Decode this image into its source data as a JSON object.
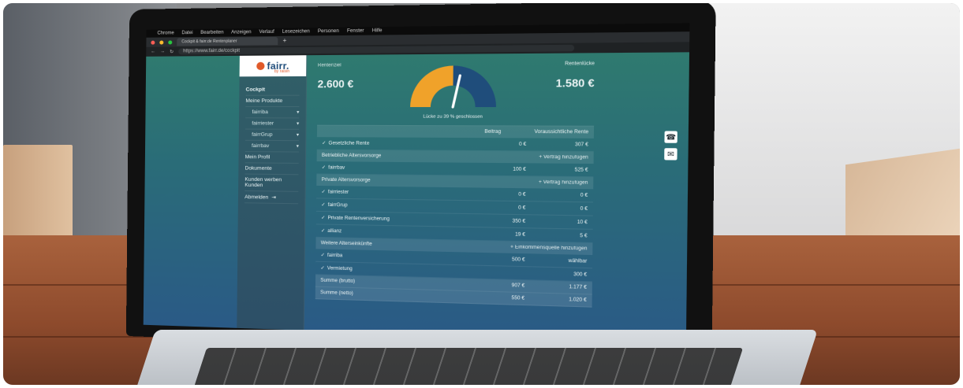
{
  "colors": {
    "brand_orange": "#e05a2a",
    "brand_blue": "#1f4d7b",
    "gauge_blue": "#1f4d7b",
    "gauge_orange": "#f0a22a",
    "app_gradient_top": "#2f7a6f",
    "app_gradient_bottom": "#2a5a86"
  },
  "browser": {
    "menubar": [
      "Chrome",
      "Datei",
      "Bearbeiten",
      "Anzeigen",
      "Verlauf",
      "Lesezeichen",
      "Personen",
      "Fenster",
      "Hilfe"
    ],
    "tab_title": "Cockpit & fairr.de Rentenplaner",
    "url": "https://www.fairr.de/cockpit"
  },
  "app": {
    "logo_text": "fairr.",
    "logo_sub": "by raisin",
    "sidebar": {
      "items": [
        {
          "label": "Cockpit",
          "active": true
        },
        {
          "label": "Meine Produkte",
          "active": false
        }
      ],
      "subitems": [
        {
          "label": "fairriba"
        },
        {
          "label": "fairriester"
        },
        {
          "label": "fairrGrup"
        },
        {
          "label": "fairrbav"
        }
      ],
      "after": [
        {
          "label": "Mein Profil"
        },
        {
          "label": "Dokumente"
        },
        {
          "label": "Kunden werben Kunden"
        }
      ],
      "logout_label": "Abmelden"
    },
    "kpis": {
      "left_label": "Rentenziel",
      "left_value": "2.600 €",
      "right_label": "Rentenlücke",
      "right_value": "1.580 €",
      "gauge_caption": "Lücke zu 39 % geschlossen"
    },
    "table": {
      "headers": [
        "Beitrag",
        "Voraussichtliche Rente"
      ],
      "rows_main": [
        {
          "type": "row",
          "name": "Gesetzliche Rente",
          "beitrag": "0 €",
          "rente": "307 €"
        },
        {
          "type": "section",
          "title": "Betriebliche Altersvorsorge",
          "action": "+ Vertrag hinzufügen"
        },
        {
          "type": "row",
          "name": "fairrbav",
          "beitrag": "100 €",
          "rente": "525 €"
        },
        {
          "type": "section",
          "title": "Private Altersvorsorge",
          "action": "+ Vertrag hinzufügen"
        },
        {
          "type": "row",
          "name": "fairriester",
          "beitrag": "0 €",
          "rente": "0 €"
        },
        {
          "type": "row",
          "name": "fairrGrup",
          "beitrag": "0 €",
          "rente": "0 €"
        },
        {
          "type": "row",
          "name": "Private Rentenversicherung",
          "beitrag": "350 €",
          "rente": "10 €"
        },
        {
          "type": "row",
          "name": "allianz",
          "beitrag": "19 €",
          "rente": "5 €"
        },
        {
          "type": "section",
          "title": "Weitere Alterseinkünfte",
          "action": "+ Einkommensquelle hinzufügen"
        },
        {
          "type": "row",
          "name": "fairriba",
          "beitrag": "500 €",
          "rente": "wählbar"
        },
        {
          "type": "row",
          "name": "Vermietung",
          "beitrag": "",
          "rente": "300 €"
        }
      ],
      "sums": [
        {
          "label": "Summe (brutto)",
          "beitrag": "907 €",
          "rente": "1.177 €"
        },
        {
          "label": "Summe (netto)",
          "beitrag": "550 €",
          "rente": "1.020 €"
        }
      ]
    }
  }
}
